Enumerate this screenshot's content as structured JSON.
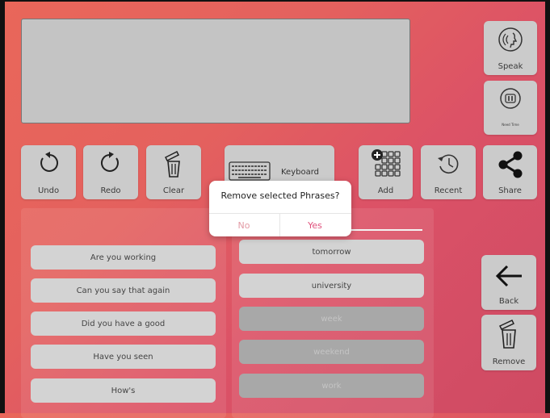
{
  "toolbar": {
    "undo": "Undo",
    "redo": "Redo",
    "clear": "Clear",
    "keyboard": "Keyboard",
    "add": "Add",
    "recent": "Recent",
    "share": "Share"
  },
  "side": {
    "speak": "Speak",
    "need_time": "Need Time",
    "back": "Back",
    "remove": "Remove"
  },
  "phrases_left": [
    "Are you working",
    "Can you say that again",
    "Did you have a good",
    "Have you seen",
    "How's"
  ],
  "phrases_right": [
    "tomorrow",
    "university",
    "week",
    "weekend",
    "work"
  ],
  "dialog": {
    "title": "Remove selected Phrases?",
    "no": "No",
    "yes": "Yes"
  },
  "colors": {
    "accent": "#e0507c",
    "tile": "#cbcbcb",
    "background": "#e3605e"
  },
  "icons": [
    "speak-icon",
    "need-time-icon",
    "undo-icon",
    "redo-icon",
    "trash-icon",
    "keyboard-icon",
    "add-grid-icon",
    "recent-icon",
    "share-icon",
    "back-arrow-icon",
    "remove-trash-icon"
  ]
}
